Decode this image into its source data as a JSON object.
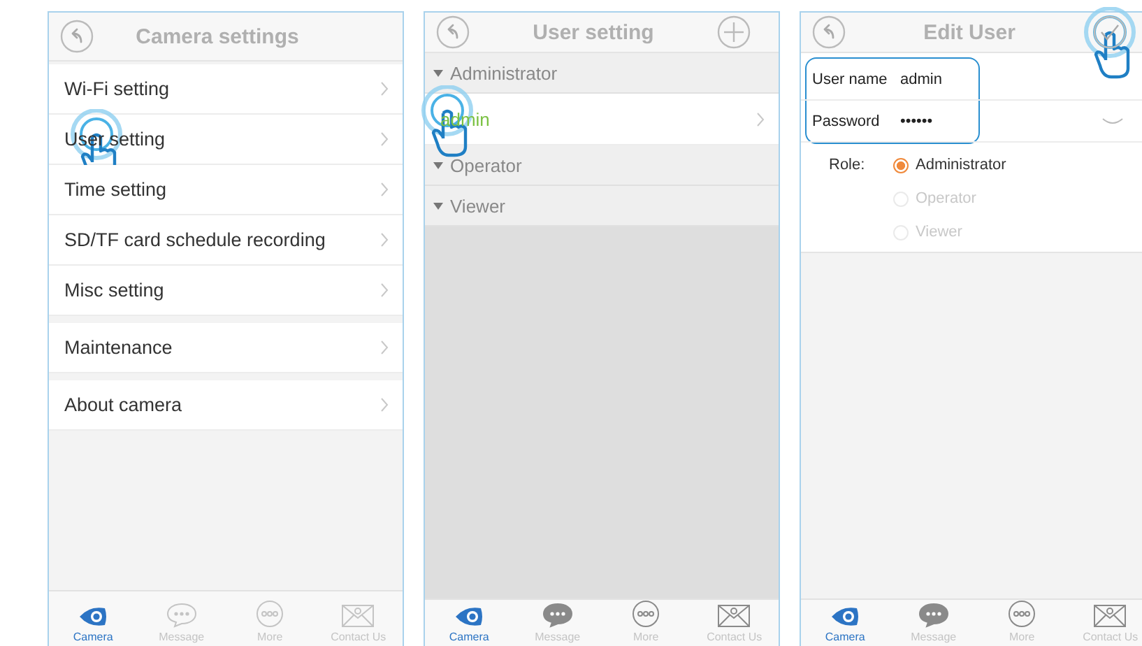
{
  "screens": [
    {
      "kind": "menu",
      "header": {
        "title": "Camera settings"
      },
      "groups": [
        [
          {
            "label": "Wi-Fi setting",
            "tapped": false
          },
          {
            "label": "User setting",
            "tapped": true
          },
          {
            "label": "Time setting",
            "tapped": false
          },
          {
            "label": "SD/TF card schedule recording",
            "tapped": false
          },
          {
            "label": "Misc setting",
            "tapped": false
          }
        ],
        [
          {
            "label": "Maintenance",
            "tapped": false
          }
        ],
        [
          {
            "label": "About camera",
            "tapped": false
          }
        ]
      ],
      "tabs": [
        {
          "label": "Camera",
          "selected": true
        },
        {
          "label": "Message",
          "selected": false
        },
        {
          "label": "More",
          "selected": false
        },
        {
          "label": "Contact Us",
          "selected": false
        }
      ]
    },
    {
      "kind": "users",
      "header": {
        "title": "User setting",
        "action": {
          "kind": "add",
          "tapped": false
        }
      },
      "sections": [
        {
          "label": "Administrator",
          "expanded": true,
          "users": [
            {
              "name": "admin",
              "selected": true,
              "tapped": true
            }
          ]
        },
        {
          "label": "Operator",
          "expanded": true
        },
        {
          "label": "Viewer",
          "expanded": true
        }
      ],
      "tabs": [
        {
          "label": "Camera",
          "selected": true
        },
        {
          "label": "Message",
          "selected": false
        },
        {
          "label": "More",
          "selected": false
        },
        {
          "label": "Contact Us",
          "selected": false
        }
      ]
    },
    {
      "kind": "edit",
      "header": {
        "title": "Edit User",
        "action": {
          "kind": "confirm",
          "tapped": true
        }
      },
      "fields_highlighted": true,
      "fields": [
        {
          "label": "User name",
          "value": "admin"
        },
        {
          "label": "Password",
          "value": "••••••",
          "dropdown": true
        }
      ],
      "role": {
        "label": "Role:",
        "options": [
          {
            "label": "Administrator",
            "selected": true,
            "disabled": false
          },
          {
            "label": "Operator",
            "selected": false,
            "disabled": true
          },
          {
            "label": "Viewer",
            "selected": false,
            "disabled": true
          }
        ]
      },
      "tabs": [
        {
          "label": "Camera",
          "selected": true
        },
        {
          "label": "Message",
          "selected": false
        },
        {
          "label": "More",
          "selected": false
        },
        {
          "label": "Contact Us",
          "selected": false
        }
      ]
    }
  ]
}
